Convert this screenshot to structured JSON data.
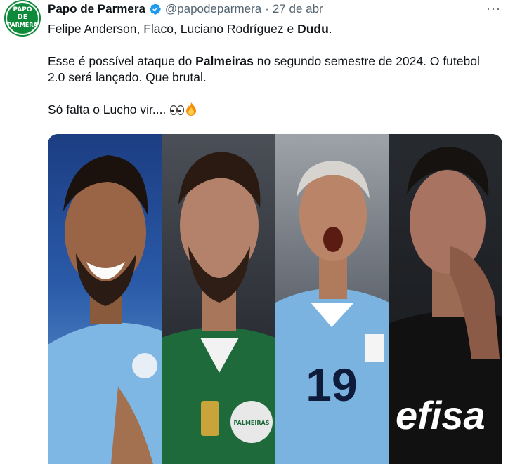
{
  "author": {
    "display_name": "Papo de Parmera",
    "handle": "@papodeparmera",
    "separator": "·",
    "date": "27 de abr",
    "avatar_text": [
      "PAPO",
      "DE",
      "PARMERA"
    ]
  },
  "more_label": "···",
  "tweet": {
    "line1": {
      "plain": "Felipe Anderson, Flaco, Luciano Rodríguez e ",
      "bold": "Dudu",
      "end": "."
    },
    "line2": {
      "pre": "Esse é possível ataque do ",
      "bold": "Palmeiras",
      "post": " no segundo semestre de 2024. O futebol 2.0 será lançado. Que brutal."
    },
    "line3": {
      "text": "Só falta o Lucho vir.... "
    }
  },
  "media": {
    "shirt_texts": [
      "efisa",
      "19",
      "PALMEIRAS"
    ]
  },
  "colors": {
    "verified": "#1d9bf0",
    "avatar": "#0e8a3a",
    "lazio_blue": "#7fb7e4",
    "palmeiras_green": "#1f6a3a",
    "uruguay_blue": "#7bb3e0",
    "black_kit": "#111111"
  }
}
